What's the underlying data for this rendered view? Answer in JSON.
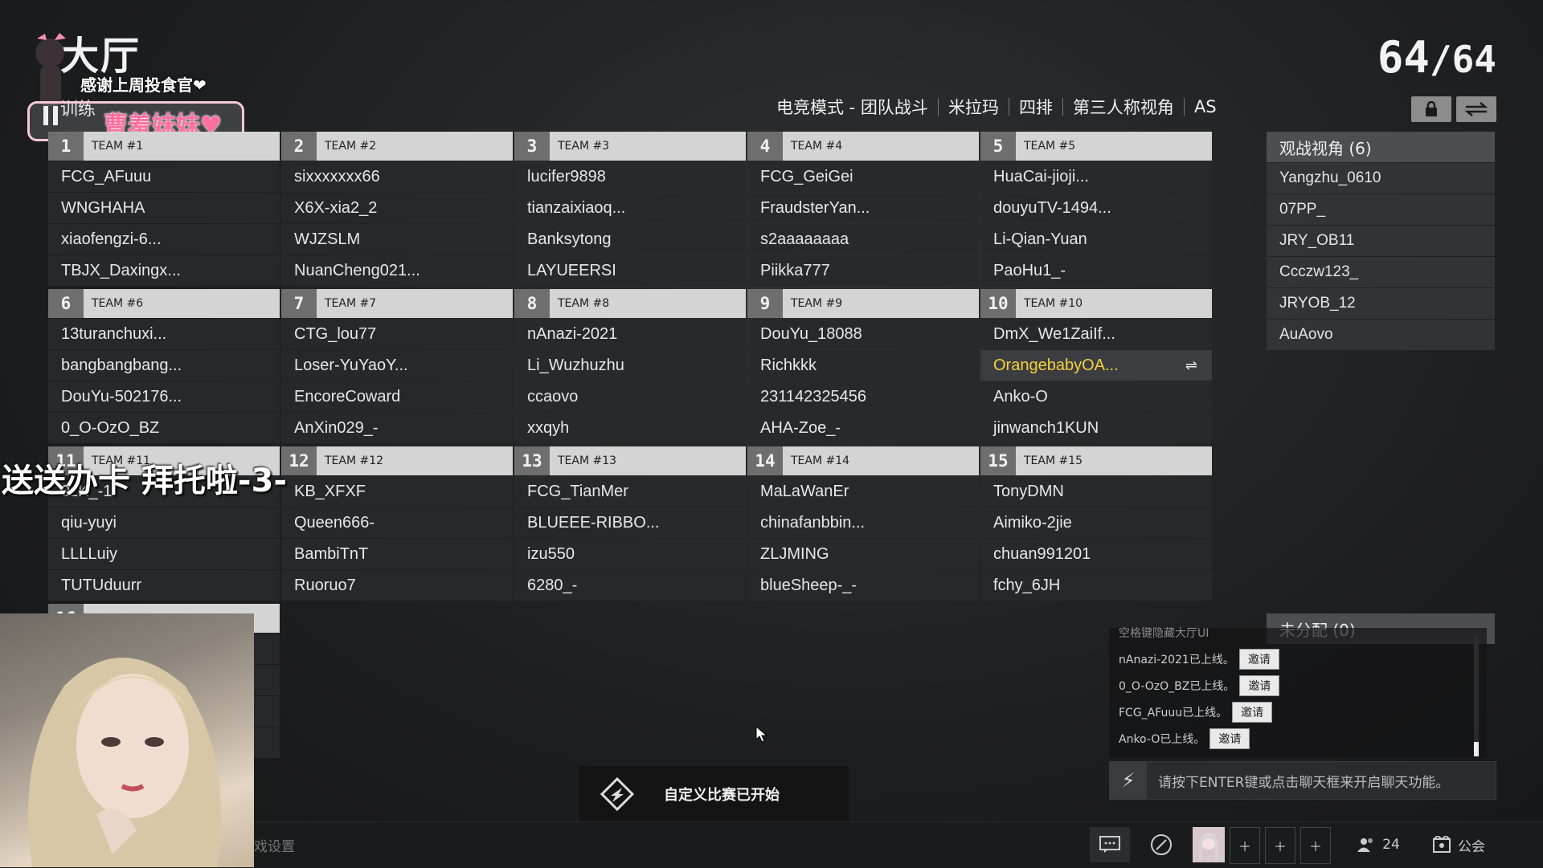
{
  "header": {
    "title": "大厅",
    "subtitle": "训练",
    "player_count_current": "64",
    "player_count_sep": "/",
    "player_count_max": "64",
    "mode_tags": [
      "电竞模式 - 团队战斗",
      "米拉玛",
      "四排",
      "第三人称视角",
      "AS"
    ]
  },
  "overlay": {
    "thanks_text": "感谢上周投食官❤",
    "streamer_badge": "曹羞妹妹♥",
    "danmaku": "送送办卡 拜托啦-3-"
  },
  "teams": [
    {
      "num": "1",
      "name": "TEAM #1",
      "players": [
        "FCG_AFuuu",
        "WNGHAHA",
        "xiaofengzi-6...",
        "TBJX_Daxingx..."
      ]
    },
    {
      "num": "2",
      "name": "TEAM #2",
      "players": [
        "sixxxxxxx66",
        "X6X-xia2_2",
        "WJZSLM",
        "NuanCheng021..."
      ]
    },
    {
      "num": "3",
      "name": "TEAM #3",
      "players": [
        "lucifer9898",
        "tianzaixiaoq...",
        "Banksytong",
        "LAYUEERSI"
      ]
    },
    {
      "num": "4",
      "name": "TEAM #4",
      "players": [
        "FCG_GeiGei",
        "FraudsterYan...",
        "s2aaaaaaaa",
        "Piikka777"
      ]
    },
    {
      "num": "5",
      "name": "TEAM #5",
      "players": [
        "HuaCai-jioji...",
        "douyuTV-1494...",
        "Li-Qian-Yuan",
        "PaoHu1_-"
      ]
    },
    {
      "num": "6",
      "name": "TEAM #6",
      "players": [
        "13turanchuxi...",
        "bangbangbang...",
        "DouYu-502176...",
        "0_O-OzO_BZ"
      ]
    },
    {
      "num": "7",
      "name": "TEAM #7",
      "players": [
        "CTG_lou77",
        "Loser-YuYaoY...",
        "EncoreCoward",
        "AnXin029_-"
      ]
    },
    {
      "num": "8",
      "name": "TEAM #8",
      "players": [
        "nAnazi-2021",
        "Li_Wuzhuzhu",
        "ccaovo",
        "xxqyh"
      ]
    },
    {
      "num": "9",
      "name": "TEAM #9",
      "players": [
        "DouYu_18088",
        "Richkkk",
        "231142325456",
        "AHA-Zoe_-"
      ]
    },
    {
      "num": "10",
      "name": "TEAM #10",
      "players": [
        "DmX_We1ZaiIf...",
        "OrangebabyOA...",
        "Anko-O",
        "jinwanch1KUN"
      ]
    },
    {
      "num": "11",
      "name": "TEAM #11",
      "players": [
        "9zK_-1",
        "qiu-yuyi",
        "LLLLuiy",
        "TUTUduurr"
      ]
    },
    {
      "num": "12",
      "name": "TEAM #12",
      "players": [
        "KB_XFXF",
        "Queen666-",
        "BambiTnT",
        "Ruoruo7"
      ]
    },
    {
      "num": "13",
      "name": "TEAM #13",
      "players": [
        "FCG_TianMer",
        "BLUEEE-RIBBO...",
        "izu550",
        "6280_-"
      ]
    },
    {
      "num": "14",
      "name": "TEAM #14",
      "players": [
        "MaLaWanEr",
        "chinafanbbin...",
        "ZLJMING",
        "blueSheep-_-"
      ]
    },
    {
      "num": "15",
      "name": "TEAM #15",
      "players": [
        "TonyDMN",
        "Aimiko-2jie",
        "chuan991201",
        "fchy_6JH"
      ]
    },
    {
      "num": "16",
      "name": "",
      "players": [
        "",
        "",
        "",
        ""
      ]
    }
  ],
  "highlighted_player": "OrangebabyOA...",
  "spectators": {
    "title": "观战视角 (6)",
    "items": [
      "Yangzhu_0610",
      "07PP_",
      "JRY_OB11",
      "Ccczw123_",
      "JRYOB_12",
      "AuAovo"
    ]
  },
  "unassigned": {
    "title": "未分配 (0)"
  },
  "chat": {
    "partial_line": "空格键隐藏大厅UI",
    "lines": [
      {
        "text": "nAnazi-2021已上线。",
        "btn": "邀请"
      },
      {
        "text": "0_O-OzO_BZ已上线。",
        "btn": "邀请"
      },
      {
        "text": "FCG_AFuuu已上线。",
        "btn": "邀请"
      },
      {
        "text": "Anko-O已上线。",
        "btn": "邀请"
      }
    ],
    "input_placeholder": "请按下ENTER键或点击聊天框来开启聊天功能。"
  },
  "toast": {
    "text": "自定义比赛已开始"
  },
  "bottom": {
    "game_settings_label": "戏设置",
    "friends_count": "24",
    "guild_label": "公会"
  },
  "colors": {
    "highlight": "#f5d23a",
    "team_header": "#d4d4d4",
    "team_num_bg": "#6e6e6e"
  }
}
